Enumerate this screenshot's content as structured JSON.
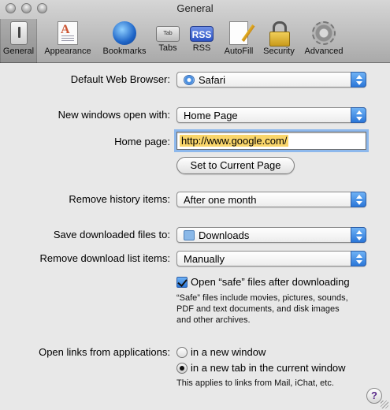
{
  "window": {
    "title": "General"
  },
  "toolbar": {
    "items": [
      {
        "label": "General",
        "icon": "switch-icon",
        "selected": true
      },
      {
        "label": "Appearance",
        "icon": "font-page-icon"
      },
      {
        "label": "Bookmarks",
        "icon": "globe-icon"
      },
      {
        "label": "Tabs",
        "icon": "tab-icon",
        "icon_text": "Tab"
      },
      {
        "label": "RSS",
        "icon": "rss-icon",
        "icon_text": "RSS"
      },
      {
        "label": "AutoFill",
        "icon": "pencil-page-icon"
      },
      {
        "label": "Security",
        "icon": "lock-icon"
      },
      {
        "label": "Advanced",
        "icon": "gear-icon"
      }
    ]
  },
  "form": {
    "default_browser": {
      "label": "Default Web Browser:",
      "value": "Safari",
      "icon": "compass-icon"
    },
    "new_windows": {
      "label": "New windows open with:",
      "value": "Home Page"
    },
    "home_page": {
      "label": "Home page:",
      "value": "http://www.google.com/"
    },
    "set_current_button": "Set to Current Page",
    "remove_history": {
      "label": "Remove history items:",
      "value": "After one month"
    },
    "save_downloads": {
      "label": "Save downloaded files to:",
      "value": "Downloads",
      "icon": "folder-icon"
    },
    "remove_download_list": {
      "label": "Remove download list items:",
      "value": "Manually"
    },
    "open_safe": {
      "label": "Open “safe” files after downloading",
      "checked": true,
      "note": [
        "“Safe” files include movies, pictures, sounds,",
        "PDF and text documents, and disk images",
        "and other archives."
      ]
    },
    "open_links": {
      "label": "Open links from applications:",
      "options": [
        {
          "label": "in a new window",
          "selected": false
        },
        {
          "label": "in a new tab in the current window",
          "selected": true
        }
      ],
      "note": "This applies to links from Mail, iChat, etc."
    },
    "help_label": "?"
  },
  "colors": {
    "accent": "#2b77d9",
    "selection": "#f9d56a",
    "focus_ring": "#8db8ec"
  }
}
